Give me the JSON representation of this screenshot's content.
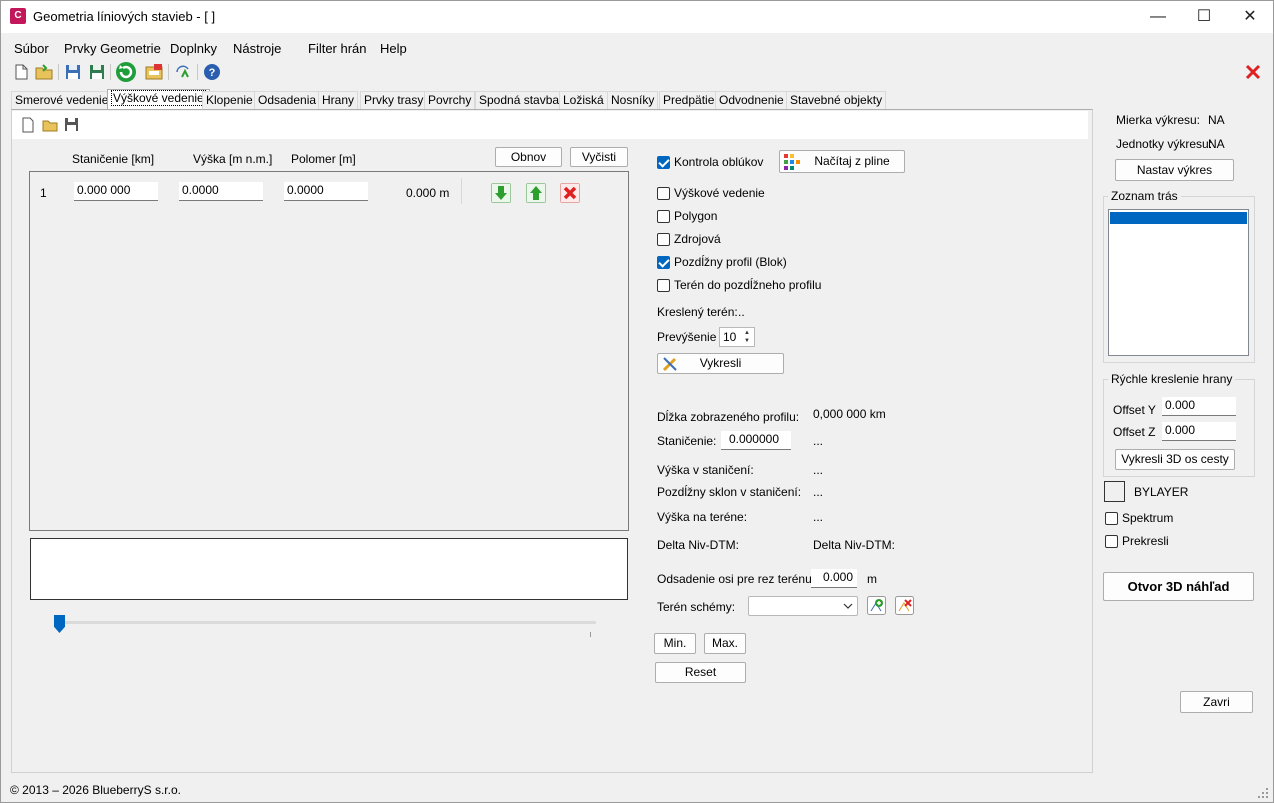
{
  "window": {
    "title": "Geometria líniových stavieb - [ ]",
    "app_icon": "C"
  },
  "window_controls": {
    "minimize": "—",
    "maximize": "☐",
    "close": "✕"
  },
  "menu": [
    {
      "label": "Súbor"
    },
    {
      "label": "Prvky Geometrie"
    },
    {
      "label": "Doplnky"
    },
    {
      "label": "Nástroje"
    },
    {
      "label": "Filter hrán"
    },
    {
      "label": "Help"
    }
  ],
  "tabs": [
    {
      "label": "Smerové vedenie"
    },
    {
      "label": "Výškové vedenie",
      "active": true
    },
    {
      "label": "Klopenie"
    },
    {
      "label": "Odsadenia"
    },
    {
      "label": "Hrany"
    },
    {
      "label": "Prvky trasy"
    },
    {
      "label": "Povrchy"
    },
    {
      "label": "Spodná stavba"
    },
    {
      "label": "Ložiská"
    },
    {
      "label": "Nosníky"
    },
    {
      "label": "Predpätie"
    },
    {
      "label": "Odvodnenie"
    },
    {
      "label": "Stavebné objekty"
    }
  ],
  "table": {
    "headers": {
      "station": "Staničenie [km]",
      "height": "Výška [m n.m.]",
      "radius": "Polomer [m]"
    },
    "refresh_label": "Obnov",
    "clear_label": "Vyčisti",
    "rows": [
      {
        "index": "1",
        "station": "0.000 000",
        "height": "0.0000",
        "radius": "0.0000",
        "length": "0.000 m"
      }
    ]
  },
  "slider": {
    "value": 0
  },
  "options": {
    "curve_check": {
      "label": "Kontrola oblúkov",
      "checked": true
    },
    "load_pline_label": "Načítaj z pline",
    "vertical_alignment": {
      "label": "Výškové vedenie",
      "checked": false
    },
    "polygon": {
      "label": "Polygon",
      "checked": false
    },
    "source": {
      "label": "Zdrojová",
      "checked": false
    },
    "long_profile": {
      "label": "Pozdĺžny profil (Blok)",
      "checked": true
    },
    "terrain_to_profile": {
      "label": "Terén do pozdĺžneho profilu",
      "checked": false
    },
    "drawn_terrain_label": "Kreslený terén:",
    "drawn_terrain_value": "..",
    "exaggeration_label": "Prevýšenie",
    "exaggeration_value": "10",
    "draw_label": "Vykresli"
  },
  "info": {
    "profile_length_label": "Dĺžka zobrazeného profilu:",
    "profile_length_value": "0,000 000 km",
    "station_label": "Staničenie:",
    "station_value": "0.000000",
    "station_extra": "...",
    "height_at_station_label": "Výška v staničení:",
    "height_at_station_value": "...",
    "slope_label": "Pozdĺžny sklon v staničení:",
    "slope_value": "...",
    "terrain_height_label": "Výška na teréne:",
    "terrain_height_value": "...",
    "delta_label": "Delta Niv-DTM:",
    "delta_value": "Delta Niv-DTM:",
    "axis_offset_label": "Odsadenie osi pre rez terénu:",
    "axis_offset_value": "0.000",
    "axis_offset_unit": "m",
    "scheme_terrain_label": "Terén schémy:",
    "scheme_terrain_value": "",
    "min_label": "Min.",
    "max_label": "Max.",
    "reset_label": "Reset"
  },
  "right": {
    "scale_label": "Mierka výkresu:",
    "scale_value": "NA",
    "units_label": "Jednotky výkresu:",
    "units_value": "NA",
    "set_drawing_label": "Nastav výkres",
    "routes_title": "Zoznam trás",
    "quick_edge_title": "Rýchle kreslenie hrany",
    "offset_y_label": "Offset Y",
    "offset_y_value": "0.000",
    "offset_z_label": "Offset Z",
    "offset_z_value": "0.000",
    "draw_3d_label": "Vykresli 3D os cesty",
    "layer_label": "BYLAYER",
    "spectrum": {
      "label": "Spektrum",
      "checked": false
    },
    "redraw": {
      "label": "Prekresli",
      "checked": false
    },
    "preview_3d_label": "Otvor 3D náhľad",
    "close_label": "Zavri"
  },
  "status": {
    "copyright": "© 2013 – 2026 BlueberryS s.r.o."
  },
  "colors": {
    "accent": "#0067c0",
    "close_red": "#e02020",
    "arrow_green": "#2e9e2e"
  }
}
